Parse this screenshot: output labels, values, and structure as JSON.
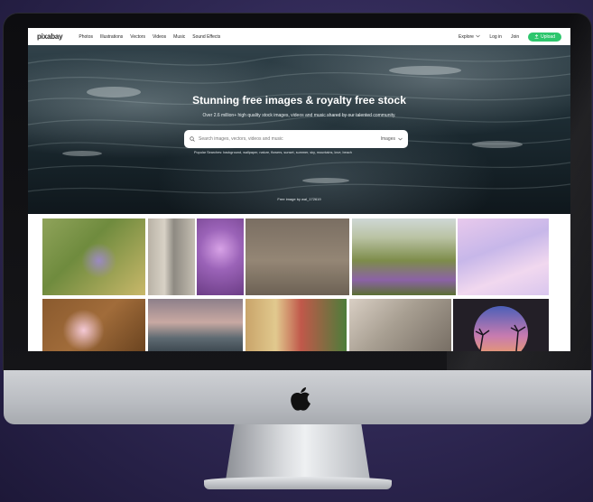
{
  "nav": {
    "logo": "pixabay",
    "links": [
      "Photos",
      "Illustrations",
      "Vectors",
      "Videos",
      "Music",
      "Sound Effects"
    ],
    "explore": "Explore",
    "login": "Log in",
    "join": "Join",
    "upload": "Upload"
  },
  "hero": {
    "title": "Stunning free images & royalty free stock",
    "subtitle": "Over 2.6 million+ high quality stock images, videos and music shared by our talented community.",
    "search_placeholder": "Search images, vectors, videos and music",
    "search_category": "Images",
    "popular": "Popular Searches: background, wallpaper, nature, flowers, sunset, summer, sky, mountains, love, beach",
    "credit": "Free image by wal_172619"
  },
  "colors": {
    "accent": "#2ec66d",
    "hero_dark": "#1c2b32"
  },
  "icons": [
    "apple-logo-icon",
    "search-icon",
    "chevron-down-icon",
    "upload-icon"
  ]
}
